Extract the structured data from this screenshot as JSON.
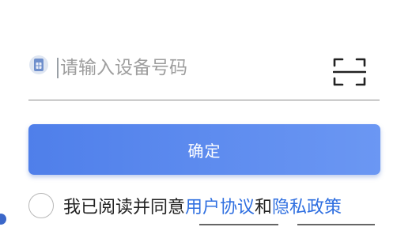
{
  "device": {
    "placeholder": "请输入设备号码",
    "value": "",
    "sim_icon": "sim-card-icon",
    "scan_icon": "scan-icon"
  },
  "confirm": {
    "label": "确定"
  },
  "agreement": {
    "prefix": "我已阅读并同意",
    "user_agreement": "用户协议",
    "conjunction": "和",
    "privacy_policy": "隐私政策",
    "checked": false
  },
  "colors": {
    "accent": "#4f7fea",
    "link": "#2f6fe0"
  }
}
